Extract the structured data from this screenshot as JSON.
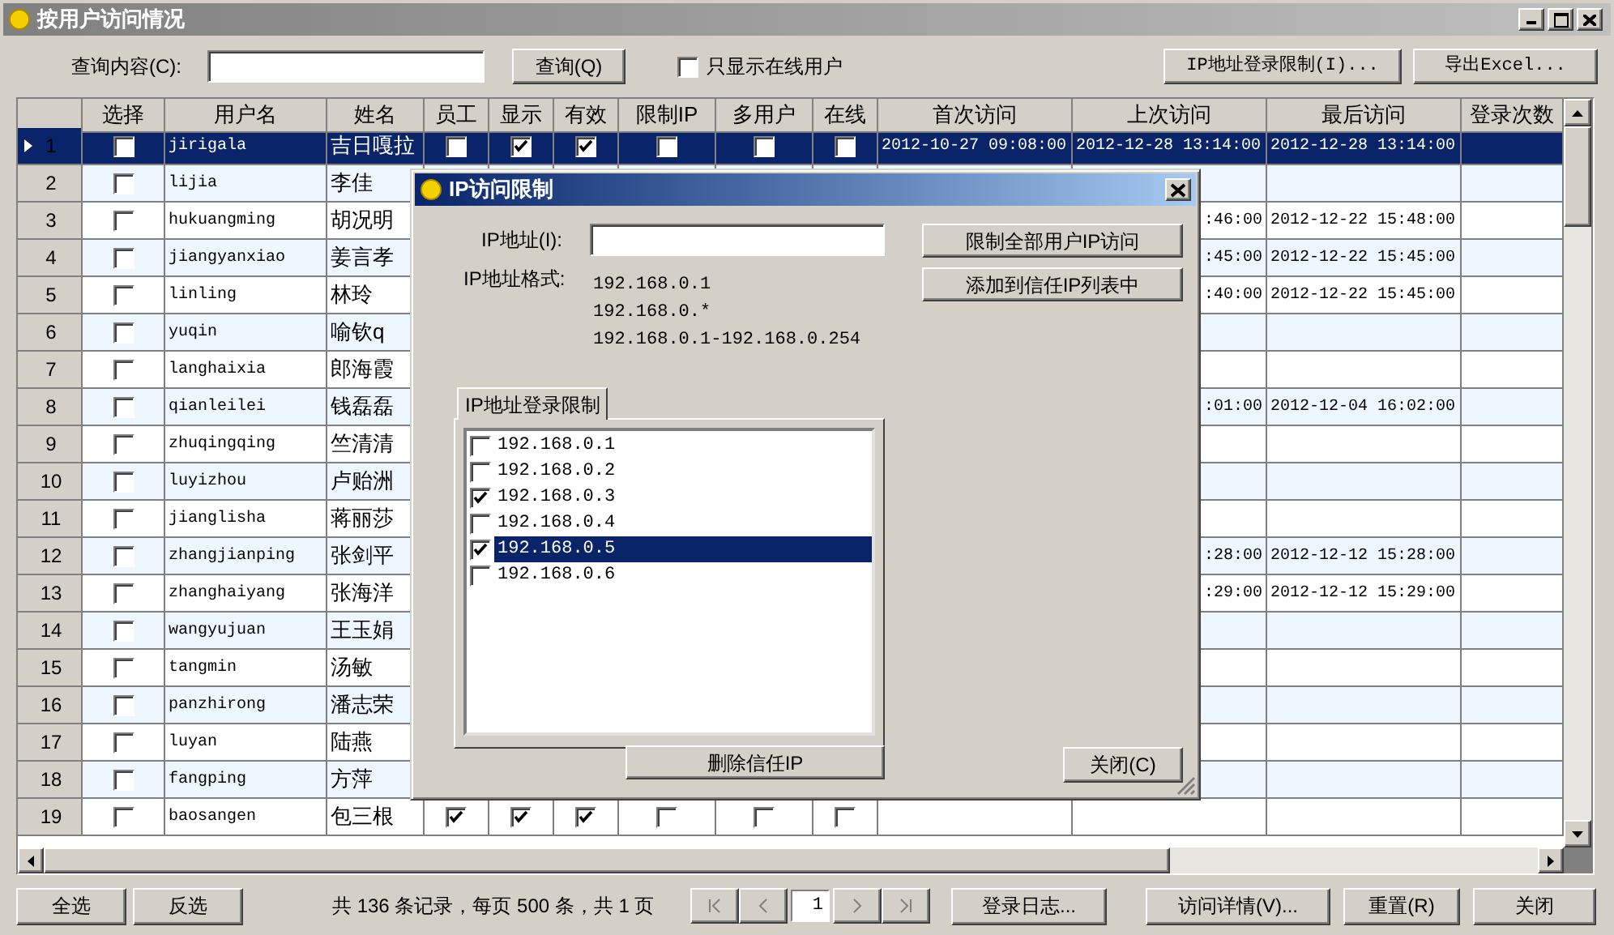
{
  "window": {
    "title": "按用户访问情况"
  },
  "toolbar": {
    "search_label": "查询内容(C):",
    "search_button": "查询(Q)",
    "online_only": {
      "label": "只显示在线用户",
      "checked": false
    },
    "buttons": [
      "IP地址登录限制(I)...",
      "导出Excel..."
    ]
  },
  "table": {
    "columns": [
      "选择",
      "用户名",
      "姓名",
      "员工",
      "显示",
      "有效",
      "限制IP",
      "多用户",
      "在线",
      "首次访问",
      "上次访问",
      "最后访问",
      "登录次数"
    ],
    "rows": [
      {
        "number": "1",
        "selected": true,
        "select": false,
        "username": "jirigala",
        "name": "吉日嘎拉",
        "employee": false,
        "display": true,
        "valid": true,
        "limit_ip": false,
        "multi_user": false,
        "online": false,
        "first_visit": "2012-10-27 09:08:00",
        "last_visit": "2012-12-28 13:14:00",
        "final_visit": "2012-12-28 13:14:00"
      },
      {
        "number": "2",
        "selected": false,
        "select": false,
        "username": "lijia",
        "name": "李佳"
      },
      {
        "number": "3",
        "selected": false,
        "select": false,
        "username": "hukuangming",
        "name": "胡况明",
        "last_visit": ":46:00",
        "final_visit": "2012-12-22 15:48:00"
      },
      {
        "number": "4",
        "selected": false,
        "select": false,
        "username": "jiangyanxiao",
        "name": "姜言孝",
        "last_visit": ":45:00",
        "final_visit": "2012-12-22 15:45:00"
      },
      {
        "number": "5",
        "selected": false,
        "select": false,
        "username": "linling",
        "name": "林玲",
        "last_visit": ":40:00",
        "final_visit": "2012-12-22 15:45:00"
      },
      {
        "number": "6",
        "selected": false,
        "select": false,
        "username": "yuqin",
        "name": "喻钦q"
      },
      {
        "number": "7",
        "selected": false,
        "select": false,
        "username": "langhaixia",
        "name": "郎海霞"
      },
      {
        "number": "8",
        "selected": false,
        "select": false,
        "username": "qianleilei",
        "name": "钱磊磊",
        "last_visit": ":01:00",
        "final_visit": "2012-12-04 16:02:00"
      },
      {
        "number": "9",
        "selected": false,
        "select": false,
        "username": "zhuqingqing",
        "name": "竺清清"
      },
      {
        "number": "10",
        "selected": false,
        "select": false,
        "username": "luyizhou",
        "name": "卢贻洲"
      },
      {
        "number": "11",
        "selected": false,
        "select": false,
        "username": "jianglisha",
        "name": "蒋丽莎"
      },
      {
        "number": "12",
        "selected": false,
        "select": false,
        "username": "zhangjianping",
        "name": "张剑平",
        "last_visit": ":28:00",
        "final_visit": "2012-12-12 15:28:00"
      },
      {
        "number": "13",
        "selected": false,
        "select": false,
        "username": "zhanghaiyang",
        "name": "张海洋",
        "last_visit": ":29:00",
        "final_visit": "2012-12-12 15:29:00"
      },
      {
        "number": "14",
        "selected": false,
        "select": false,
        "username": "wangyujuan",
        "name": "王玉娟"
      },
      {
        "number": "15",
        "selected": false,
        "select": false,
        "username": "tangmin",
        "name": "汤敏"
      },
      {
        "number": "16",
        "selected": false,
        "select": false,
        "username": "panzhirong",
        "name": "潘志荣"
      },
      {
        "number": "17",
        "selected": false,
        "select": false,
        "username": "luyan",
        "name": "陆燕"
      },
      {
        "number": "18",
        "selected": false,
        "select": false,
        "username": "fangping",
        "name": "方萍"
      },
      {
        "number": "19",
        "selected": false,
        "select": false,
        "username": "baosangen",
        "name": "包三根",
        "employee": true,
        "display": true,
        "valid": true,
        "limit_ip": false,
        "multi_user": false,
        "online": false
      }
    ]
  },
  "dialog": {
    "title": "IP访问限制",
    "ip_label": "IP地址(I):",
    "format_label": "IP地址格式:",
    "format_examples": [
      "192.168.0.1",
      "192.168.0.*",
      "192.168.0.1-192.168.0.254"
    ],
    "buttons": [
      "限制全部用户IP访问",
      "添加到信任IP列表中"
    ],
    "tab": {
      "label": "IP地址登录限制",
      "selected": true
    },
    "ip_list": [
      {
        "ip": "192.168.0.1",
        "checked": false,
        "selected": false
      },
      {
        "ip": "192.168.0.2",
        "checked": false,
        "selected": false
      },
      {
        "ip": "192.168.0.3",
        "checked": true,
        "selected": false
      },
      {
        "ip": "192.168.0.4",
        "checked": false,
        "selected": false
      },
      {
        "ip": "192.168.0.5",
        "checked": true,
        "selected": true
      },
      {
        "ip": "192.168.0.6",
        "checked": false,
        "selected": false
      }
    ],
    "delete_button": "删除信任IP",
    "close_button": "关闭(C)"
  },
  "footer": {
    "buttons_left": [
      "全选",
      "反选"
    ],
    "summary": "共 136 条记录，每页 500 条，共 1 页",
    "page": "1",
    "buttons_right": [
      "登录日志...",
      "访问详情(V)...",
      "重置(R)",
      "关闭"
    ]
  }
}
